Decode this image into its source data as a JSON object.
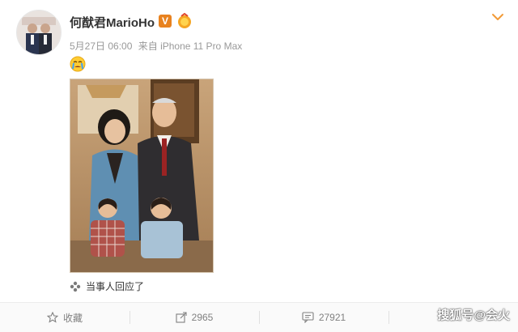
{
  "post": {
    "username": "何猷君MarioHo",
    "verified_badge": "V",
    "date": "5月27日 06:00",
    "source": "来自 iPhone 11 Pro Max",
    "emoji": "crying-emoji",
    "reply_note": "当事人回应了"
  },
  "actions": {
    "favorite_label": "收藏",
    "repost_count": "2965",
    "comment_count": "27921"
  },
  "watermark": "搜狐号@会火",
  "colors": {
    "accent_orange": "#e8821f",
    "meta_gray": "#999999",
    "action_gray": "#808080"
  }
}
